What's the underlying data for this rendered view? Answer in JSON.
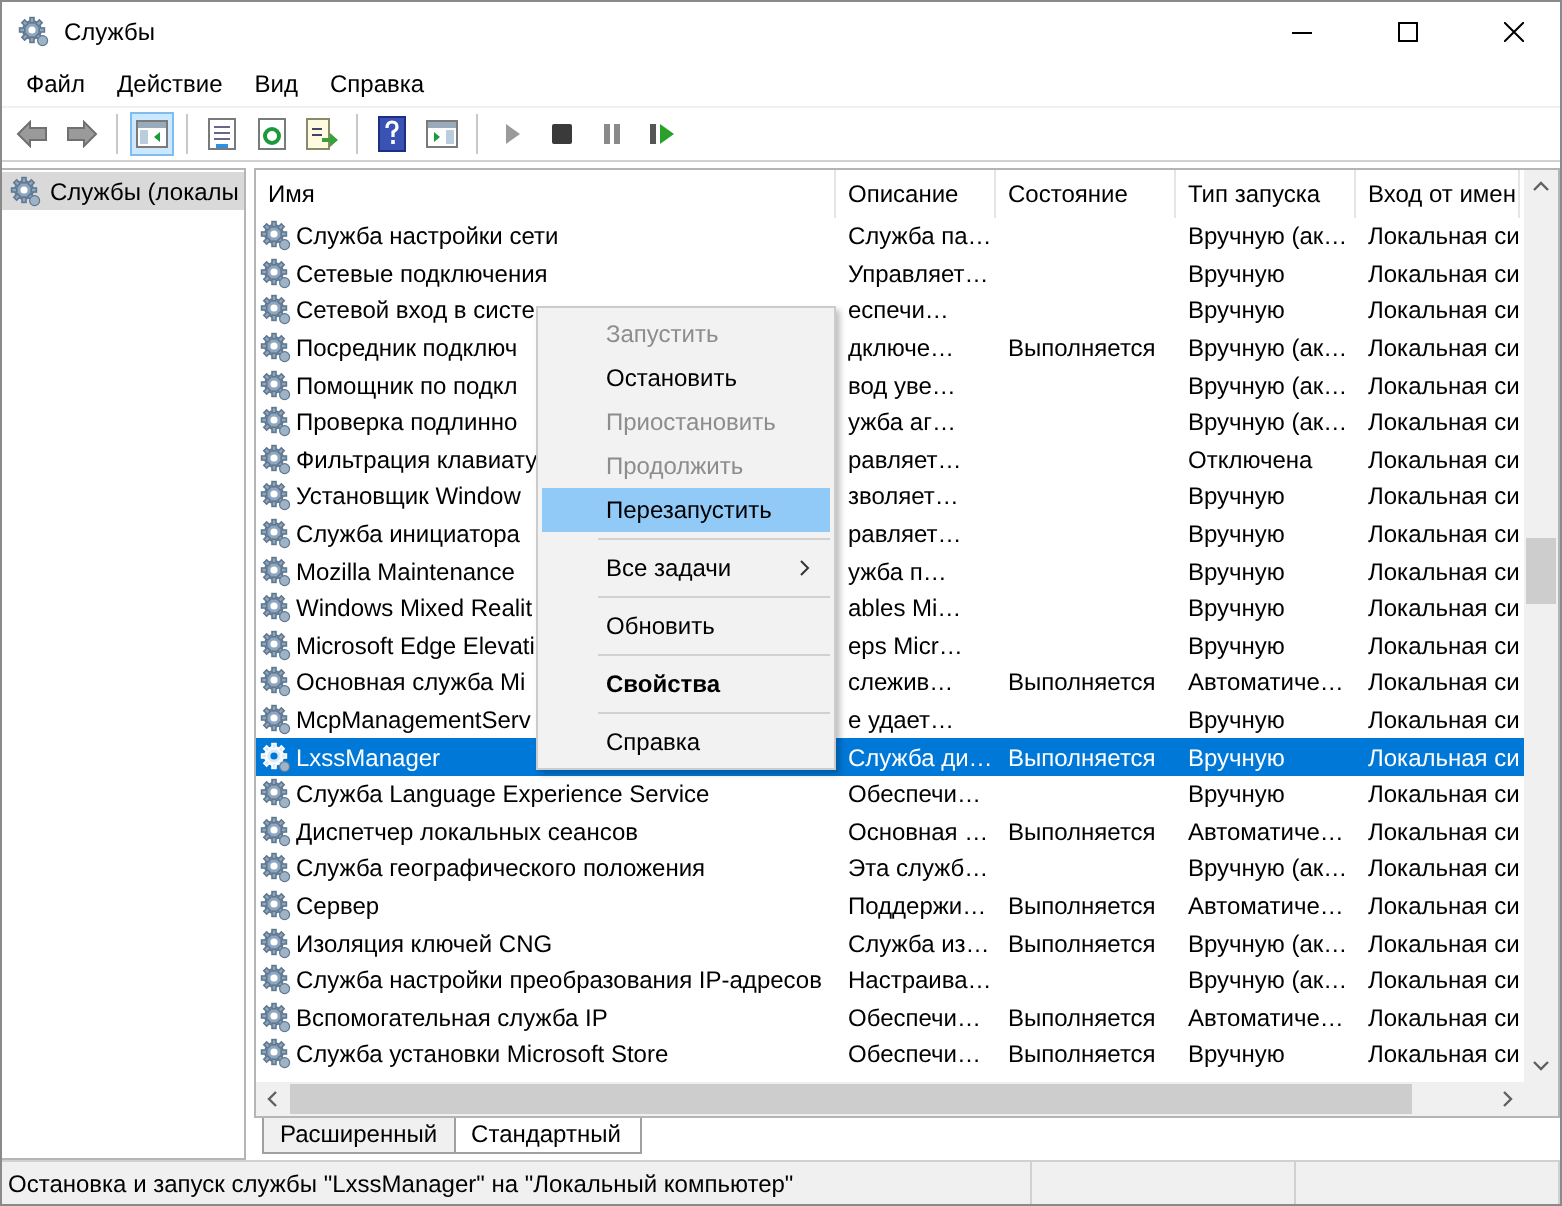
{
  "window": {
    "title": "Службы"
  },
  "menu_bar": [
    {
      "label": "Файл"
    },
    {
      "label": "Действие"
    },
    {
      "label": "Вид"
    },
    {
      "label": "Справка"
    }
  ],
  "toolbar": [
    {
      "kind": "back",
      "pressed": false
    },
    {
      "kind": "forward",
      "pressed": false
    },
    {
      "kind": "separator"
    },
    {
      "kind": "tree",
      "pressed": true
    },
    {
      "kind": "separator"
    },
    {
      "kind": "properties",
      "pressed": false
    },
    {
      "kind": "refresh",
      "pressed": false
    },
    {
      "kind": "export",
      "pressed": false
    },
    {
      "kind": "separator"
    },
    {
      "kind": "help",
      "pressed": false
    },
    {
      "kind": "console",
      "pressed": false
    },
    {
      "kind": "separator"
    },
    {
      "kind": "play",
      "pressed": false
    },
    {
      "kind": "stop",
      "pressed": false
    },
    {
      "kind": "pause",
      "pressed": false
    },
    {
      "kind": "resume",
      "pressed": false
    }
  ],
  "tree": {
    "items": [
      {
        "label": "Службы (локалы",
        "selected": true
      }
    ]
  },
  "table": {
    "columns": [
      "Имя",
      "Описание",
      "Состояние",
      "Тип запуска",
      "Вход от имен"
    ],
    "rows": [
      {
        "name": "Служба настройки сети",
        "description": "Служба па…",
        "startup": "Вручную (ак…",
        "logon": "Локальная си",
        "selected": false
      },
      {
        "name": "Сетевые подключения",
        "description": "Управляет…",
        "startup": "Вручную",
        "logon": "Локальная си",
        "selected": false
      },
      {
        "name": "Сетевой вход в систе",
        "description": "еспечи…",
        "startup": "Вручную",
        "logon": "Локальная си",
        "selected": false
      },
      {
        "name": "Посредник подключ",
        "description": "дключе…",
        "status": "Выполняется",
        "startup": "Вручную (ак…",
        "logon": "Локальная си",
        "selected": false
      },
      {
        "name": "Помощник по подкл",
        "description": "вод уве…",
        "startup": "Вручную (ак…",
        "logon": "Локальная си",
        "selected": false
      },
      {
        "name": "Проверка подлинно",
        "description": "ужба аг…",
        "startup": "Вручную (ак…",
        "logon": "Локальная си",
        "selected": false
      },
      {
        "name": "Фильтрация клавиату",
        "description": "равляет…",
        "startup": "Отключена",
        "logon": "Локальная си",
        "selected": false
      },
      {
        "name": "Установщик Window",
        "description": "зволяет…",
        "startup": "Вручную",
        "logon": "Локальная си",
        "selected": false
      },
      {
        "name": "Служба инициатора",
        "description": "равляет…",
        "startup": "Вручную",
        "logon": "Локальная си",
        "selected": false
      },
      {
        "name": "Mozilla Maintenance",
        "description": "ужба п…",
        "startup": "Вручную",
        "logon": "Локальная си",
        "selected": false
      },
      {
        "name": "Windows Mixed Realit",
        "description": "ables Mi…",
        "startup": "Вручную",
        "logon": "Локальная си",
        "selected": false
      },
      {
        "name": "Microsoft Edge Elevati",
        "description": "eps Micr…",
        "startup": "Вручную",
        "logon": "Локальная си",
        "selected": false
      },
      {
        "name": "Основная служба Mi",
        "description": "слежив…",
        "status": "Выполняется",
        "startup": "Автоматиче…",
        "logon": "Локальная си",
        "selected": false
      },
      {
        "name": "McpManagementServ",
        "description": "е удает…",
        "startup": "Вручную",
        "logon": "Локальная си",
        "selected": false
      },
      {
        "name": "LxssManager",
        "description": "Служба ди…",
        "status": "Выполняется",
        "startup": "Вручную",
        "logon": "Локальная си",
        "selected": true
      },
      {
        "name": "Служба Language Experience Service",
        "description": "Обеспечи…",
        "startup": "Вручную",
        "logon": "Локальная си",
        "selected": false
      },
      {
        "name": "Диспетчер локальных сеансов",
        "description": "Основная …",
        "status": "Выполняется",
        "startup": "Автоматиче…",
        "logon": "Локальная си",
        "selected": false
      },
      {
        "name": "Служба географического положения",
        "description": "Эта служб…",
        "startup": "Вручную (ак…",
        "logon": "Локальная си",
        "selected": false
      },
      {
        "name": "Сервер",
        "description": "Поддержи…",
        "status": "Выполняется",
        "startup": "Автоматиче…",
        "logon": "Локальная си",
        "selected": false
      },
      {
        "name": "Изоляция ключей CNG",
        "description": "Служба из…",
        "status": "Выполняется",
        "startup": "Вручную (ак…",
        "logon": "Локальная си",
        "selected": false
      },
      {
        "name": "Служба настройки преобразования IP-адресов",
        "description": "Настраива…",
        "startup": "Вручную (ак…",
        "logon": "Локальная си",
        "selected": false
      },
      {
        "name": "Вспомогательная служба IP",
        "description": "Обеспечи…",
        "status": "Выполняется",
        "startup": "Автоматиче…",
        "logon": "Локальная си",
        "selected": false
      },
      {
        "name": "Служба установки Microsoft Store",
        "description": "Обеспечи…",
        "status": "Выполняется",
        "startup": "Вручную",
        "logon": "Локальная си",
        "selected": false
      }
    ]
  },
  "context_menu": [
    {
      "kind": "item",
      "label": "Запустить",
      "disabled": true,
      "selected": false,
      "default": false,
      "submenu": false
    },
    {
      "kind": "item",
      "label": "Остановить",
      "disabled": false,
      "selected": false,
      "default": false,
      "submenu": false
    },
    {
      "kind": "item",
      "label": "Приостановить",
      "disabled": true,
      "selected": false,
      "default": false,
      "submenu": false
    },
    {
      "kind": "item",
      "label": "Продолжить",
      "disabled": true,
      "selected": false,
      "default": false,
      "submenu": false
    },
    {
      "kind": "item",
      "label": "Перезапустить",
      "disabled": false,
      "selected": true,
      "default": false,
      "submenu": false
    },
    {
      "kind": "separator"
    },
    {
      "kind": "item",
      "label": "Все задачи",
      "disabled": false,
      "selected": false,
      "default": false,
      "submenu": true
    },
    {
      "kind": "separator"
    },
    {
      "kind": "item",
      "label": "Обновить",
      "disabled": false,
      "selected": false,
      "default": false,
      "submenu": false
    },
    {
      "kind": "separator"
    },
    {
      "kind": "item",
      "label": "Свойства",
      "disabled": false,
      "selected": false,
      "default": true,
      "submenu": false
    },
    {
      "kind": "separator"
    },
    {
      "kind": "item",
      "label": "Справка",
      "disabled": false,
      "selected": false,
      "default": false,
      "submenu": false
    }
  ],
  "view_tabs": [
    {
      "label": "Расширенный",
      "selected": false
    },
    {
      "label": "Стандартный",
      "selected": true
    }
  ],
  "status_bar": "Остановка и запуск службы \"LxssManager\" на \"Локальный компьютер\""
}
